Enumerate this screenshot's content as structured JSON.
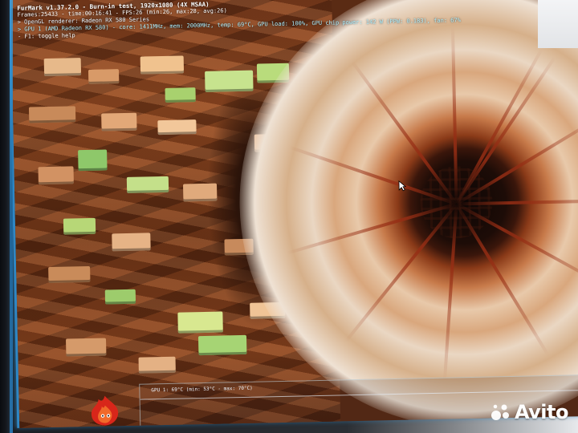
{
  "osd": {
    "title": "FurMark v1.37.2.0 - Burn-in test, 1920x1080 (4X MSAA)",
    "frames": "Frames:25433 - time:00:16:41 - FPS:26 (min:26, max:28, avg:26)",
    "renderer": "> OpenGL renderer: Radeon RX 580 Series",
    "gpu": "> GPU 1 (AMD Radeon RX 580) - core: 1411MHz, mem: 2000MHz, temp: 69°C, GPU load: 100%, GPU chip power: 142 W (PPW: 0.183), fan: 67%",
    "help": "- F1: toggle help"
  },
  "graph": {
    "label": "GPU 1: 69°C (min: 53°C - max: 70°C)"
  },
  "watermark": {
    "brand": "Avito"
  },
  "icons": {
    "logo": "furmark-flame-icon",
    "cursor": "mouse-cursor-icon",
    "watermark": "avito-dots-icon"
  },
  "colors": {
    "osd_text": "#f4f4f4",
    "gpu_line": "#aef0ff",
    "screen_edge": "#2e87c5",
    "graph_line": "#e6f0fa"
  }
}
